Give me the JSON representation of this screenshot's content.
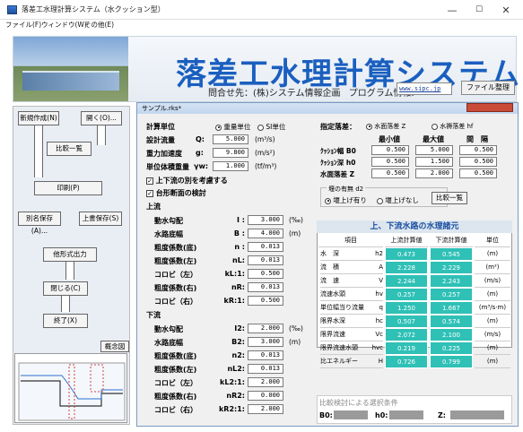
{
  "window": {
    "title": "落差工水理計算システム（水クッション型）",
    "controls": {
      "minimize": "—",
      "maximize": "☐",
      "close": "✕"
    }
  },
  "menu": [
    "ファイル(F)",
    "ウィンドウ(W)",
    "その他(E)"
  ],
  "banner": {
    "title": "落差工水理計算システム",
    "contact_label": "問合せ先：",
    "contact_company": "(株)システム情報企画",
    "program_label": "プログラム情報:",
    "url": "www.sipc.jp",
    "file_button": "ファイル整理"
  },
  "left": {
    "new": "新規作成(N)",
    "open": "開く(O)...",
    "compare": "比較一覧",
    "print": "印刷(P)",
    "save_as": "別名保存(A)...",
    "overwrite": "上書保存(S)",
    "other_output": "他形式出力",
    "close": "閉じる(C)",
    "exit": "終了(X)",
    "overview": "概念図"
  },
  "child": {
    "title": "サンプル.rks*"
  },
  "units": {
    "label": "計算単位",
    "opt1": "重量単位",
    "opt2": "SI単位"
  },
  "design": {
    "q_label": "設計流量",
    "q_sym": "Q:",
    "q_val": "5.000",
    "q_unit": "(m³/s)",
    "g_label": "重力加速度",
    "g_sym": "g:",
    "g_val": "9.800",
    "g_unit": "(m/s²)",
    "w_label": "単位体積重量",
    "w_sym": "γw:",
    "w_val": "1.000",
    "w_unit": "(tf/m³)"
  },
  "checks": {
    "c1": "上下流の別を考慮する",
    "c2": "台形断面の検討"
  },
  "up": {
    "heading": "上流",
    "rows": [
      {
        "label": "動水勾配",
        "sym": "I :",
        "val": "3.000",
        "unit": "(‰)"
      },
      {
        "label": "水路底幅",
        "sym": "B :",
        "val": "4.000",
        "unit": "(m)"
      },
      {
        "label": "粗度係数(底)",
        "sym": "n :",
        "val": "0.013",
        "unit": ""
      },
      {
        "label": "粗度係数(左)",
        "sym": "nL:",
        "val": "0.013",
        "unit": ""
      },
      {
        "label": "コロビ（左）",
        "sym": "kL:1:",
        "val": "0.500",
        "unit": ""
      },
      {
        "label": "粗度係数(右)",
        "sym": "nR:",
        "val": "0.013",
        "unit": ""
      },
      {
        "label": "コロビ（右）",
        "sym": "kR:1:",
        "val": "0.500",
        "unit": ""
      }
    ]
  },
  "down": {
    "heading": "下流",
    "rows": [
      {
        "label": "動水勾配",
        "sym": "I2:",
        "val": "2.000",
        "unit": "(‰)"
      },
      {
        "label": "水路底幅",
        "sym": "B2:",
        "val": "3.000",
        "unit": "(m)"
      },
      {
        "label": "粗度係数(底)",
        "sym": "n2:",
        "val": "0.013",
        "unit": ""
      },
      {
        "label": "粗度係数(左)",
        "sym": "nL2:",
        "val": "0.013",
        "unit": ""
      },
      {
        "label": "コロビ（左）",
        "sym": "kL2:1:",
        "val": "2.000",
        "unit": ""
      },
      {
        "label": "粗度係数(右)",
        "sym": "nR2:",
        "val": "0.000",
        "unit": ""
      },
      {
        "label": "コロビ（右）",
        "sym": "kR2:1:",
        "val": "2.000",
        "unit": ""
      }
    ]
  },
  "drop": {
    "label": "指定落差：",
    "opt1": "水面落差 Z",
    "opt2": "水褥落差 hf",
    "cols": [
      "最小値",
      "最大値",
      "間　隔"
    ],
    "rows": [
      {
        "label": "ｸｯｼｮﾝ幅 B0",
        "v": [
          "0.500",
          "5.000",
          "0.500"
        ]
      },
      {
        "label": "ｸｯｼｮﾝ深 h0",
        "v": [
          "0.500",
          "1.500",
          "0.500"
        ]
      },
      {
        "label": "水面落差 Z",
        "v": [
          "0.500",
          "2.000",
          "0.500"
        ]
      }
    ],
    "weir_label": "堰の有無 d2",
    "weir1": "堰上げ有り",
    "weir2": "堰上げなし",
    "compare_btn": "比較一覧"
  },
  "results": {
    "heading": "上、下流水路の水理諸元",
    "cols": [
      "項目",
      "上流計算値",
      "下流計算値",
      "単位"
    ],
    "rows": [
      {
        "item": "水　深",
        "sym": "h2",
        "u": "0.473",
        "d": "0.545",
        "unit": "(m)"
      },
      {
        "item": "流　積",
        "sym": "A",
        "u": "2.228",
        "d": "2.229",
        "unit": "(m²)"
      },
      {
        "item": "流　速",
        "sym": "V",
        "u": "2.244",
        "d": "2.243",
        "unit": "(m/s)"
      },
      {
        "item": "流速水頭",
        "sym": "hv",
        "u": "0.257",
        "d": "0.257",
        "unit": "(m)"
      },
      {
        "item": "単位幅当り流量",
        "sym": "q",
        "u": "1.250",
        "d": "1.667",
        "unit": "(m³/s·m)"
      },
      {
        "item": "限界水深",
        "sym": "hc",
        "u": "0.507",
        "d": "0.574",
        "unit": "(m)"
      },
      {
        "item": "限界流速",
        "sym": "Vc",
        "u": "2.072",
        "d": "2.100",
        "unit": "(m/s)"
      },
      {
        "item": "限界流速水頭",
        "sym": "hvc",
        "u": "0.219",
        "d": "0.225",
        "unit": "(m)"
      },
      {
        "item": "比エネルギー",
        "sym": "H",
        "u": "0.726",
        "d": "0.799",
        "unit": "(m)"
      }
    ]
  },
  "select": {
    "heading": "比較検討による選択条件",
    "b0": "B0:",
    "h0": "h0:",
    "z": "Z:"
  }
}
